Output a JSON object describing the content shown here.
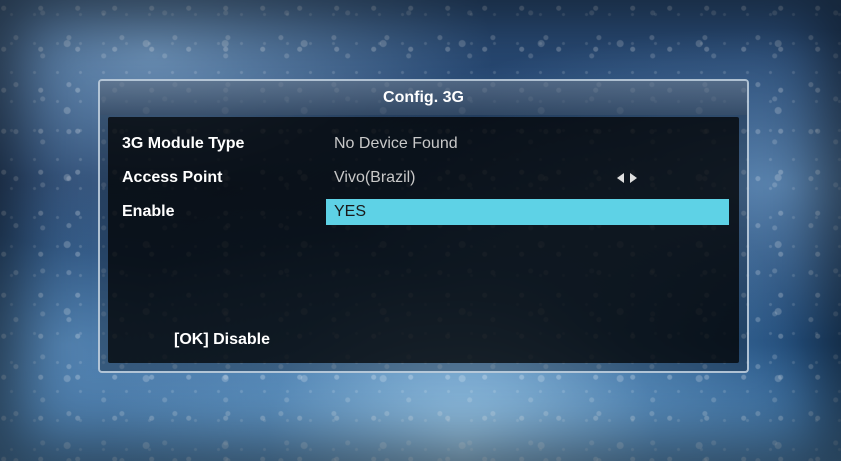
{
  "dialog": {
    "title": "Config. 3G"
  },
  "settings": [
    {
      "label": "3G Module Type",
      "value": "No Device Found",
      "selected": false
    },
    {
      "label": "Access Point",
      "value": "Vivo(Brazil)",
      "selected": false,
      "has_arrows": true
    },
    {
      "label": "Enable",
      "value": "YES",
      "selected": true
    }
  ],
  "footer": {
    "hint": "[OK] Disable"
  },
  "colors": {
    "highlight": "#5ed2e6",
    "label_text": "#ffffff",
    "value_text": "#c8c8c8"
  },
  "icons": {
    "access_point_arrows": "left-right-arrows-icon"
  }
}
